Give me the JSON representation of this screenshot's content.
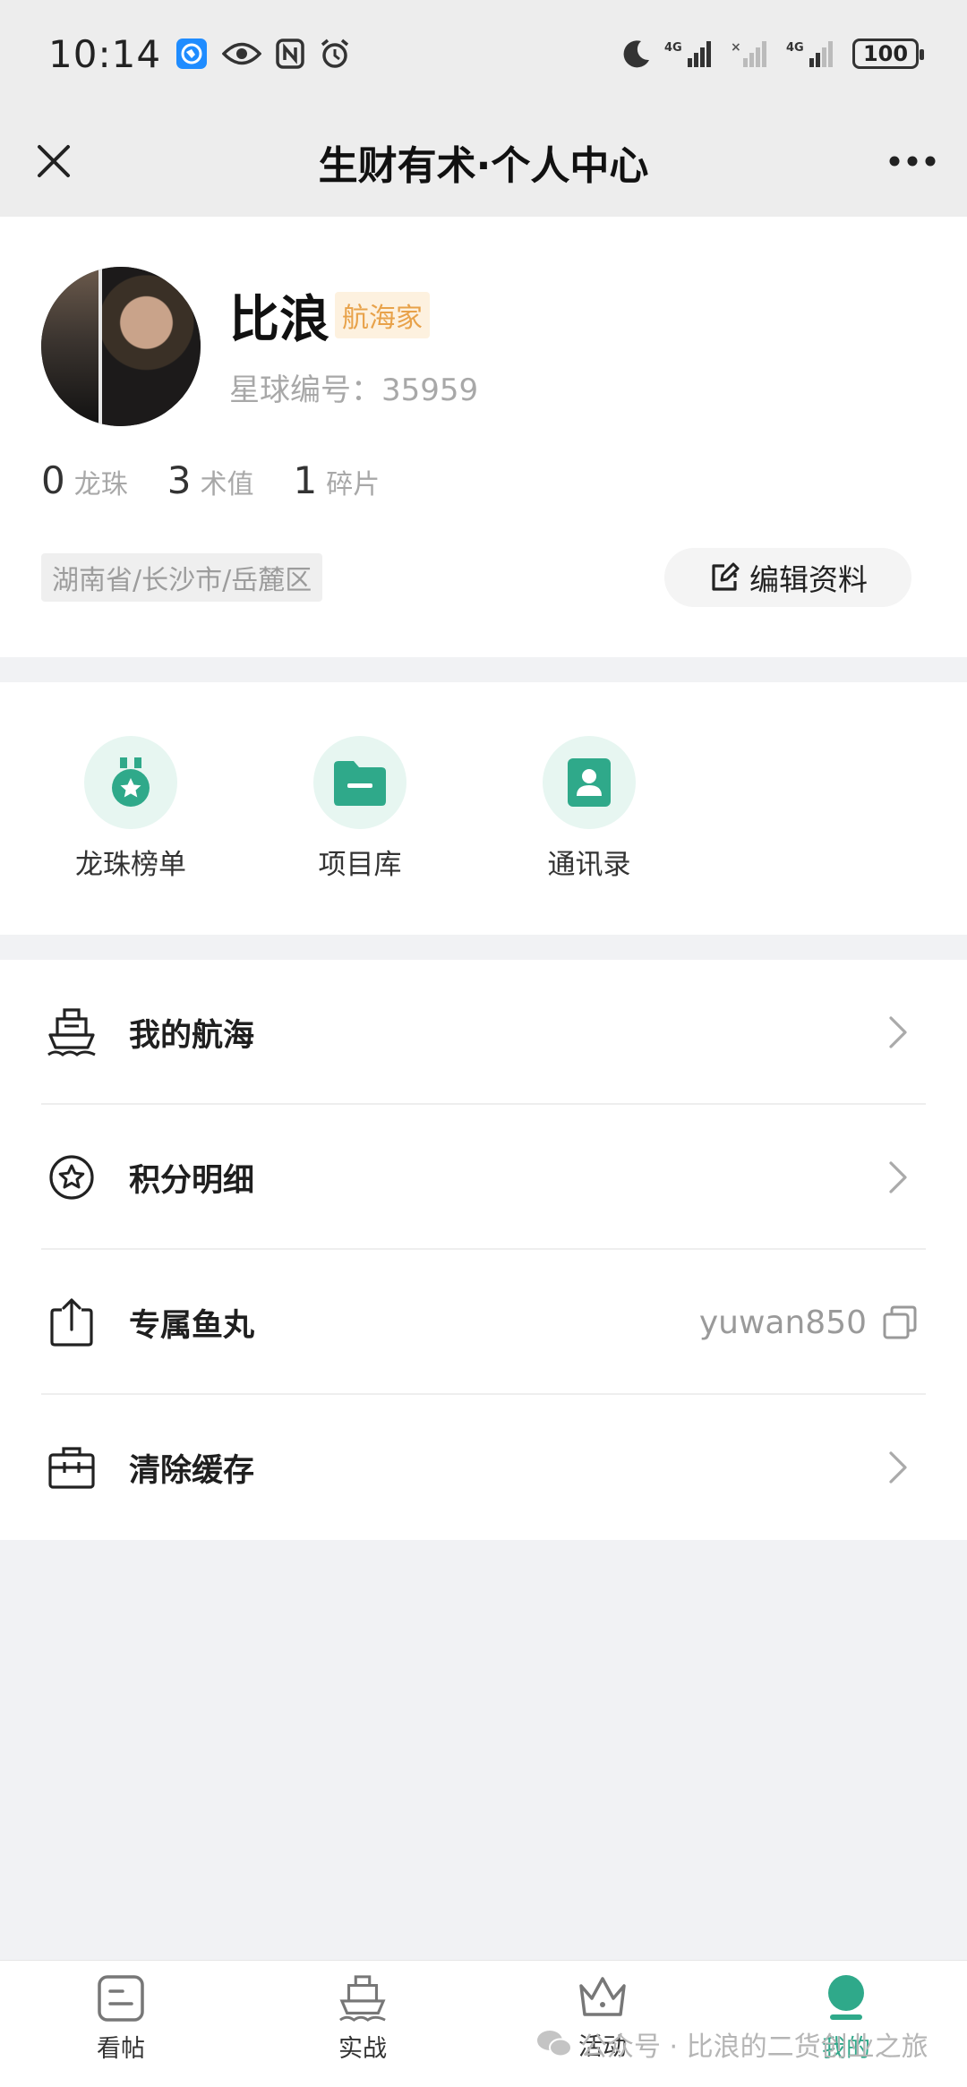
{
  "status_bar": {
    "time": "10:14",
    "battery": "100",
    "signal1": "4G",
    "signal2": "4G"
  },
  "title_bar": {
    "title": "生财有术·个人中心"
  },
  "profile": {
    "name": "比浪",
    "level": "航海家",
    "member_no": "星球编号：35959",
    "stats": [
      {
        "value": "0",
        "label": "龙珠"
      },
      {
        "value": "3",
        "label": "术值"
      },
      {
        "value": "1",
        "label": "碎片"
      }
    ],
    "location": "湖南省/长沙市/岳麓区",
    "edit_label": "编辑资料"
  },
  "quick_tools": [
    {
      "label": "龙珠榜单",
      "icon": "medal-icon"
    },
    {
      "label": "项目库",
      "icon": "folder-icon"
    },
    {
      "label": "通讯录",
      "icon": "contacts-icon"
    }
  ],
  "menu": [
    {
      "label": "我的航海",
      "icon": "ship-icon",
      "value": ""
    },
    {
      "label": "积分明细",
      "icon": "star-circle-icon",
      "value": ""
    },
    {
      "label": "专属鱼丸",
      "icon": "share-bag-icon",
      "value": "yuwan850"
    },
    {
      "label": "清除缓存",
      "icon": "toolbox-icon",
      "value": ""
    }
  ],
  "bottom_nav": [
    {
      "label": "看帖",
      "icon": "post-icon"
    },
    {
      "label": "实战",
      "icon": "ship-icon"
    },
    {
      "label": "活动",
      "icon": "crown-icon"
    },
    {
      "label": "我的",
      "icon": "profile-icon"
    }
  ],
  "watermark": "公众号 · 比浪的二货创业之旅",
  "colors": {
    "accent": "#2fa98a",
    "badge_text": "#e8a24a",
    "badge_bg": "#fdf1df"
  }
}
